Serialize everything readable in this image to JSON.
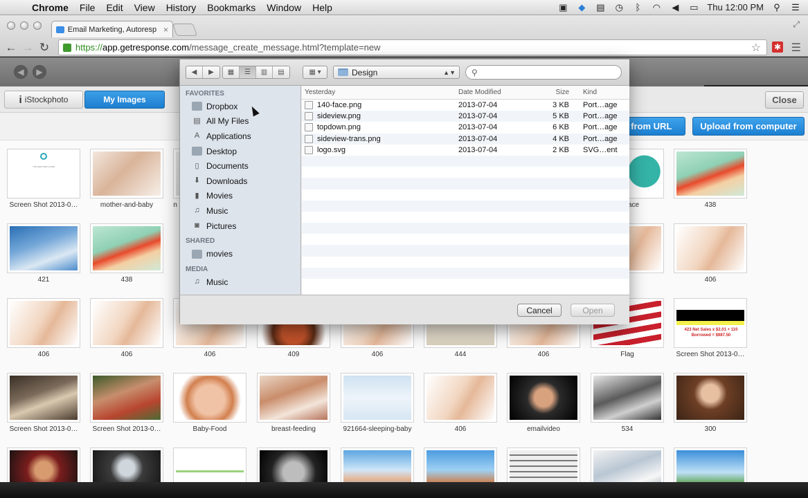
{
  "menubar": {
    "app": "Chrome",
    "items": [
      "File",
      "Edit",
      "View",
      "History",
      "Bookmarks",
      "Window",
      "Help"
    ],
    "clock": "Thu 12:00 PM",
    "status_icons": [
      "camera-icon",
      "dropbox-icon",
      "clipboard-icon",
      "time-machine-icon",
      "bluetooth-icon",
      "wifi-icon",
      "volume-icon",
      "battery-icon",
      "spotlight-icon",
      "notification-list-icon"
    ]
  },
  "browser": {
    "tab_title": "Email Marketing, Autoresp",
    "tab_close": "×",
    "url_https": "https://",
    "url_host": "app.getresponse.com",
    "url_path": "/message_create_message.html?template=new"
  },
  "panel": {
    "istock_label": "iStockphoto",
    "my_images_label": "My Images",
    "close_label": "Close",
    "upload_url_label": "d from URL",
    "upload_computer_label": "Upload from computer"
  },
  "dialog": {
    "current_folder": "Design",
    "search_placeholder": "",
    "sidebar": {
      "favorites_header": "FAVORITES",
      "favorites": [
        "Dropbox",
        "All My Files",
        "Applications",
        "Desktop",
        "Documents",
        "Downloads",
        "Movies",
        "Music",
        "Pictures"
      ],
      "shared_header": "SHARED",
      "shared": [
        "movies"
      ],
      "media_header": "MEDIA",
      "media": [
        "Music"
      ]
    },
    "columns": {
      "name": "Yesterday",
      "date": "Date Modified",
      "size": "Size",
      "kind": "Kind"
    },
    "files": [
      {
        "name": "140-face.png",
        "date": "2013-07-04",
        "size": "3 KB",
        "kind": "Port…age"
      },
      {
        "name": "sideview.png",
        "date": "2013-07-04",
        "size": "5 KB",
        "kind": "Port…age"
      },
      {
        "name": "topdown.png",
        "date": "2013-07-04",
        "size": "6 KB",
        "kind": "Port…age"
      },
      {
        "name": "sideview-trans.png",
        "date": "2013-07-04",
        "size": "4 KB",
        "kind": "Port…age"
      },
      {
        "name": "logo.svg",
        "date": "2013-07-04",
        "size": "2 KB",
        "kind": "SVG…ent"
      }
    ],
    "cancel_label": "Cancel",
    "open_label": "Open"
  },
  "gallery": {
    "row1": [
      "Screen Shot 2013-0…",
      "mother-and-baby",
      "n",
      "",
      "",
      "",
      "",
      "ace",
      "438"
    ],
    "row2": [
      "421",
      "438",
      "",
      "",
      "",
      "",
      "",
      "6",
      "406"
    ],
    "row3": [
      "406",
      "406",
      "406",
      "409",
      "406",
      "444",
      "406",
      "Flag",
      "Screen Shot 2013-0…"
    ],
    "row4": [
      "Screen Shot 2013-0…",
      "Screen Shot 2013-0…",
      "Baby-Food",
      "breast-feeding",
      "921664-sleeping-baby",
      "406",
      "emailvideo",
      "534",
      "300"
    ],
    "row5": [
      "",
      "",
      "",
      "",
      "",
      "",
      "",
      "",
      ""
    ],
    "flag_text": "423 Net Sales x $2.01 + 110 Borrowed = $987.50",
    "thumb_text": "THE NEW NEW GUIDE"
  },
  "colors": {
    "accent_blue": "#1d7fd0",
    "dialog_sidebar": "#dde4ec",
    "ext_red": "#d62e2e"
  }
}
